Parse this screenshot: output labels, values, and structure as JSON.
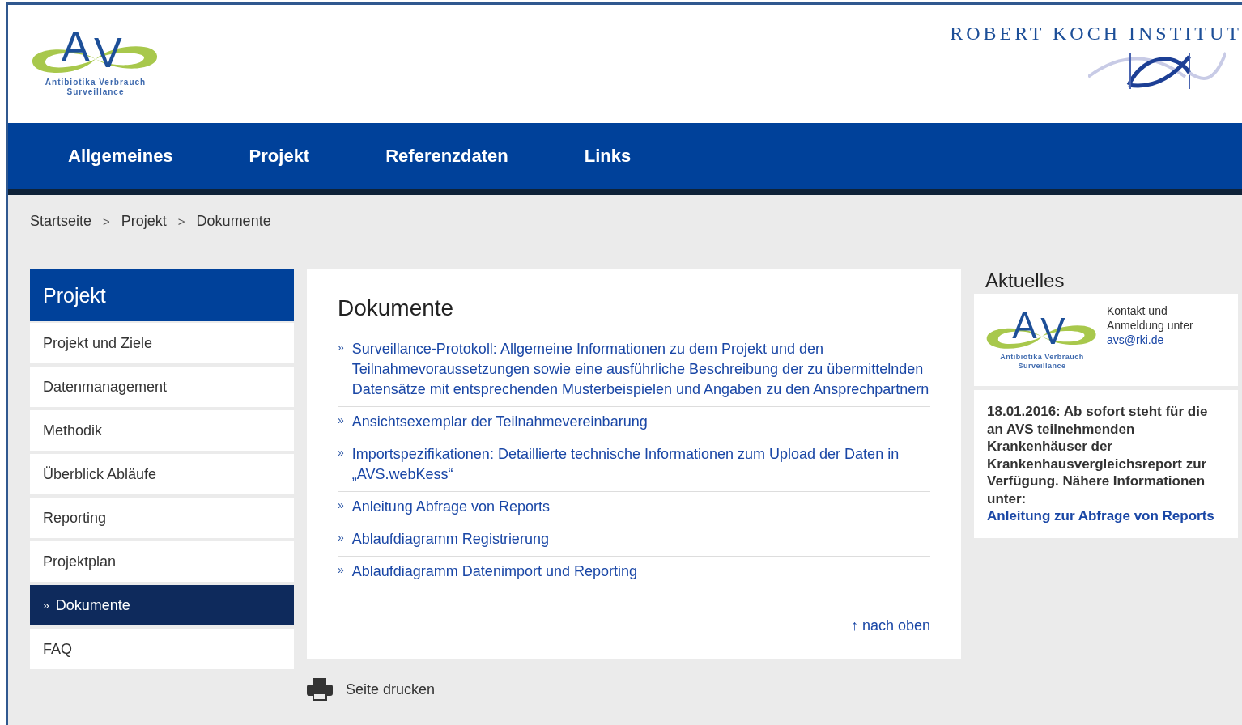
{
  "header": {
    "logo": {
      "letters": [
        "A",
        "V"
      ],
      "caption": [
        "Antibiotika Verbrauch",
        "Surveillance"
      ]
    },
    "institute": "ROBERT KOCH INSTITUT"
  },
  "nav": [
    {
      "label": "Allgemeines",
      "selected": false
    },
    {
      "label": "Projekt",
      "selected": false
    },
    {
      "label": "Referenzdaten",
      "selected": false
    },
    {
      "label": "Links",
      "selected": false
    }
  ],
  "breadcrumb": {
    "separator": ">",
    "items": [
      "Startseite",
      "Projekt",
      "Dokumente"
    ]
  },
  "sidebar": {
    "title": "Projekt",
    "marker": "»",
    "items": [
      {
        "label": "Projekt und Ziele",
        "selected": false
      },
      {
        "label": "Datenmanagement",
        "selected": false
      },
      {
        "label": "Methodik",
        "selected": false
      },
      {
        "label": "Überblick Abläufe",
        "selected": false
      },
      {
        "label": "Reporting",
        "selected": false
      },
      {
        "label": "Projektplan",
        "selected": false
      },
      {
        "label": "Dokumente",
        "selected": true
      },
      {
        "label": "FAQ",
        "selected": false
      }
    ]
  },
  "content": {
    "title": "Dokumente",
    "marker": "»",
    "documents": [
      "Surveillance-Protokoll: Allgemeine Informationen zu dem Projekt und den Teilnahmevoraussetzungen sowie eine ausführliche Beschreibung der zu übermittelnden Datensätze mit entsprechenden Musterbeispielen und Angaben zu den Ansprechpartnern",
      "Ansichtsexemplar der Teilnahmevereinbarung",
      "Importspezifikationen: Detaillierte technische Informationen zum Upload der Daten in „AVS.webKess“",
      "Anleitung Abfrage von Reports",
      "Ablaufdiagramm Registrierung",
      "Ablaufdiagramm Datenimport und Reporting"
    ],
    "to_top": {
      "arrow": "↑",
      "label": "nach oben"
    }
  },
  "print": "Seite drucken",
  "aside": {
    "title": "Aktuelles",
    "contact": {
      "logo": {
        "letters": [
          "A",
          "V"
        ],
        "caption": [
          "Antibiotika Verbrauch",
          "Surveillance"
        ]
      },
      "text": "Kontakt und Anmeldung unter",
      "email": "avs@rki.de"
    },
    "news": {
      "text": "18.01.2016: Ab sofort steht für die an AVS teilnehmenden Krankenhäuser der Krankenhausvergleichsreport zur Verfügung. Nähere Informationen unter:",
      "link": "Anleitung zur Abfrage von Reports"
    }
  }
}
